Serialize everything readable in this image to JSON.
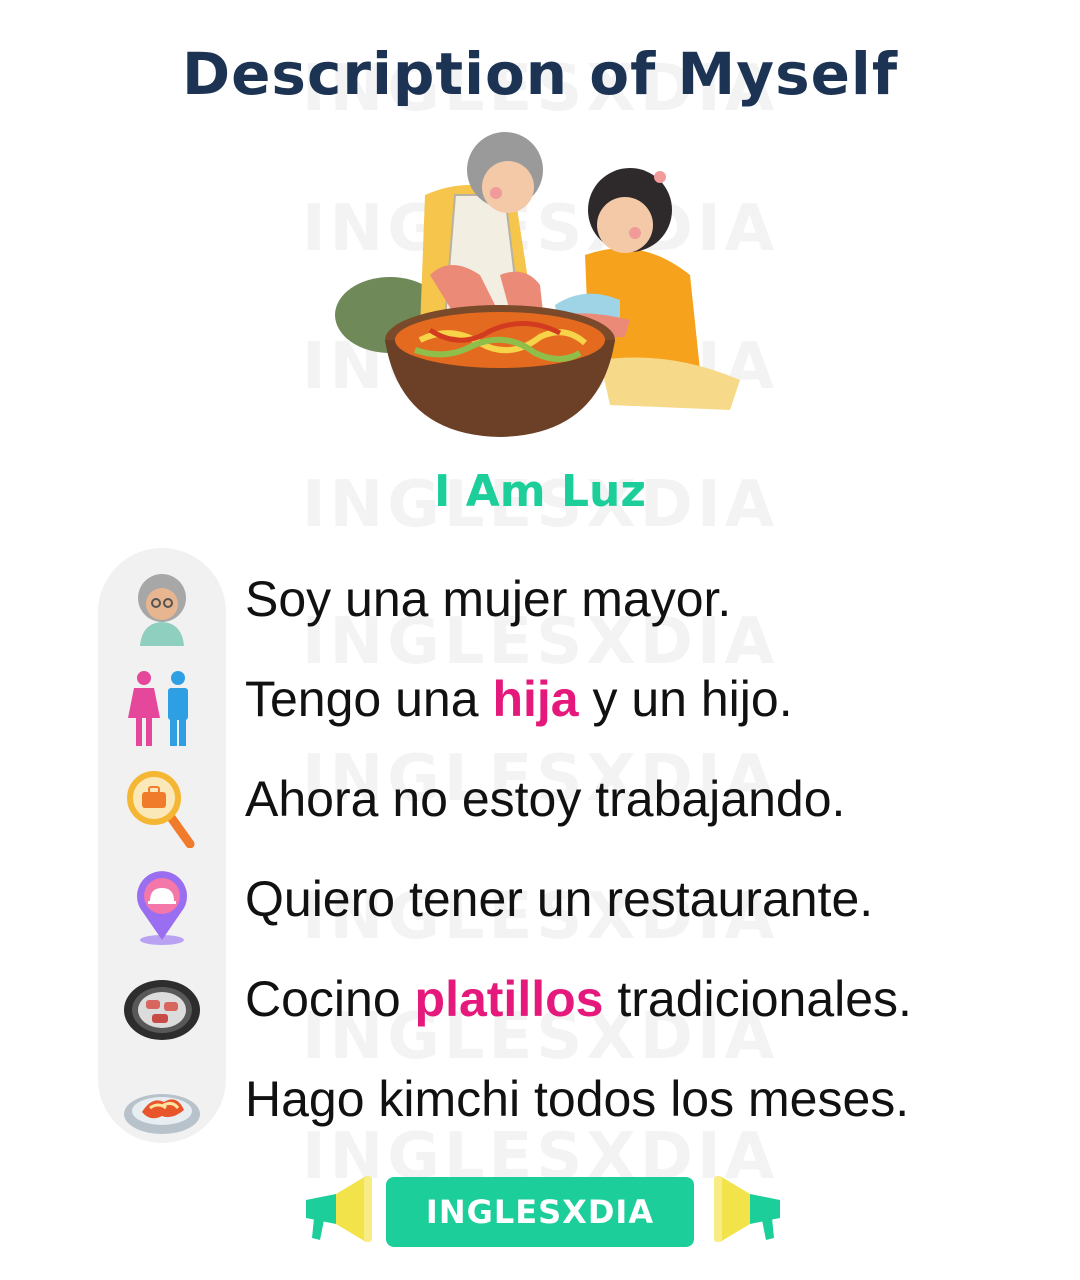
{
  "page": {
    "title": "Description of Myself",
    "subtitle": "I Am Luz",
    "watermark": "INGLESXDIA",
    "colors": {
      "title": "#1c3353",
      "accent": "#1ccf9a",
      "highlight": "#e5187b",
      "text": "#111111"
    }
  },
  "illustration": {
    "icon": "grandmother-and-girl-making-kimchi"
  },
  "items": [
    {
      "icon": "older-woman-icon",
      "parts": [
        "Soy una mujer mayor.",
        "",
        ""
      ]
    },
    {
      "icon": "man-and-woman-icon",
      "parts": [
        "Tengo una ",
        "hija",
        " y un hijo."
      ]
    },
    {
      "icon": "job-search-icon",
      "parts": [
        "Ahora no estoy trabajando.",
        "",
        ""
      ]
    },
    {
      "icon": "restaurant-pin-icon",
      "parts": [
        "Quiero tener un restaurante.",
        "",
        ""
      ]
    },
    {
      "icon": "grill-pan-icon",
      "parts": [
        "Cocino ",
        "platillos",
        " tradicionales."
      ]
    },
    {
      "icon": "kimchi-plate-icon",
      "parts": [
        "Hago kimchi todos los meses.",
        "",
        ""
      ]
    }
  ],
  "footer": {
    "brand": "INGLESXDIA"
  }
}
